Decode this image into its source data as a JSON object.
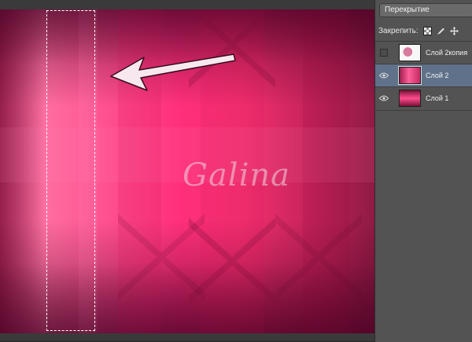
{
  "canvas": {
    "watermark": "Galina",
    "colors": {
      "accent": "#ff4d8e",
      "selection_border": "#ffffff",
      "arrow_fill": "#f6e8ee"
    }
  },
  "layers_panel": {
    "blend_mode": "Перекрытие",
    "lock_label": "Закрепить:",
    "lock_icons": [
      "transparency-lock-icon",
      "brush-lock-icon",
      "move-lock-icon"
    ],
    "layers": [
      {
        "name": "Слой 2копия",
        "visible": false,
        "selected": false,
        "thumb": "t1"
      },
      {
        "name": "Слой 2",
        "visible": true,
        "selected": true,
        "thumb": "t2"
      },
      {
        "name": "Слой 1",
        "visible": true,
        "selected": false,
        "thumb": "t3"
      }
    ],
    "colors": {
      "panel_bg": "#535353",
      "selected_bg": "#5f7289"
    }
  }
}
